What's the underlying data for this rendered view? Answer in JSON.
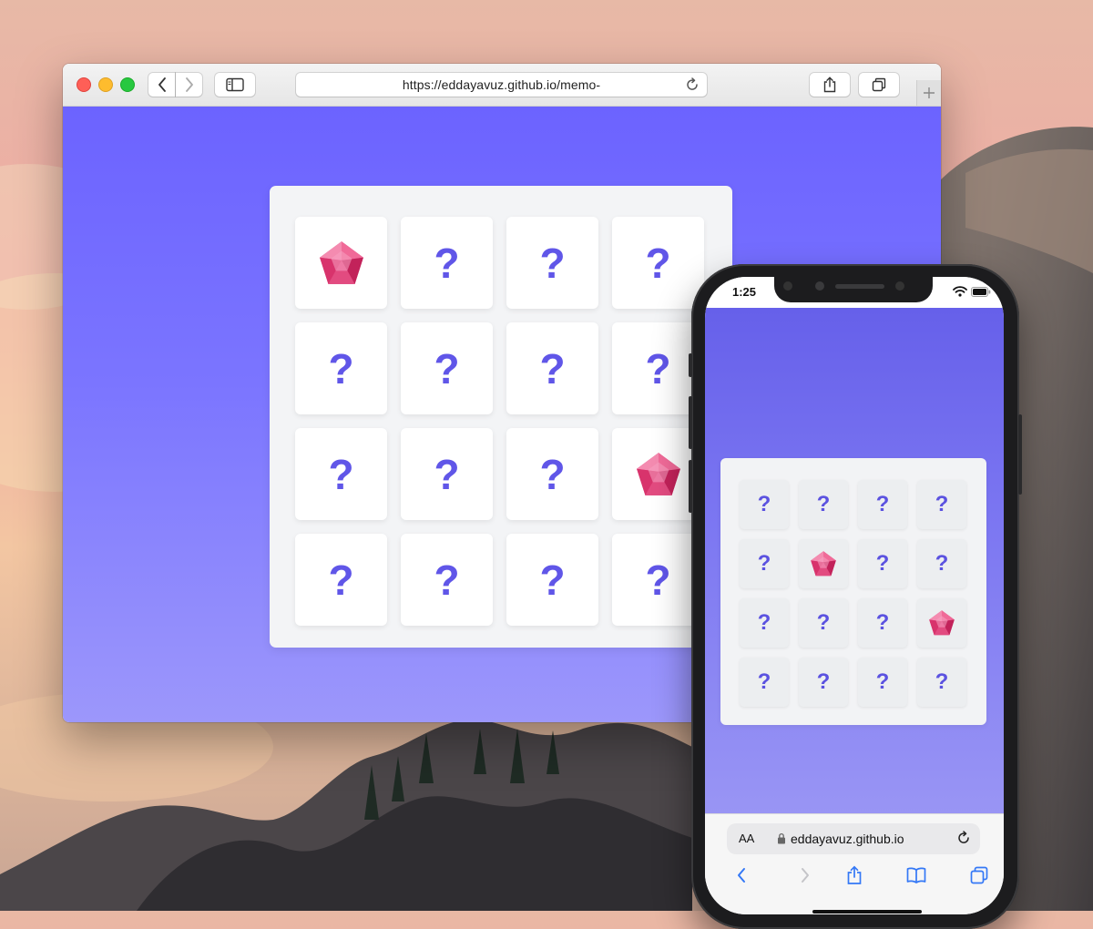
{
  "browser": {
    "url": "https://eddayavuz.github.io/memo-",
    "icons": {
      "back": "chevron-left-icon",
      "forward": "chevron-right-icon",
      "sidebar": "sidebar-icon",
      "reload": "reload-icon",
      "share": "share-icon",
      "tabs": "tabs-icon",
      "new_tab": "plus-icon"
    }
  },
  "game": {
    "hidden_symbol": "?",
    "revealed_icon": "gem-icon",
    "desktop_cards": [
      "gem",
      "?",
      "?",
      "?",
      "?",
      "?",
      "?",
      "?",
      "?",
      "?",
      "?",
      "gem",
      "?",
      "?",
      "?",
      "?"
    ],
    "mobile_cards": [
      "?",
      "?",
      "?",
      "?",
      "?",
      "gem",
      "?",
      "?",
      "?",
      "?",
      "?",
      "gem",
      "?",
      "?",
      "?",
      "?"
    ]
  },
  "phone": {
    "time": "1:25",
    "aa_label": "AA",
    "url": "eddayavuz.github.io"
  },
  "colors": {
    "accent": "#6c63ff",
    "question_mark": "#6056e8",
    "gem": "#e0407a"
  }
}
